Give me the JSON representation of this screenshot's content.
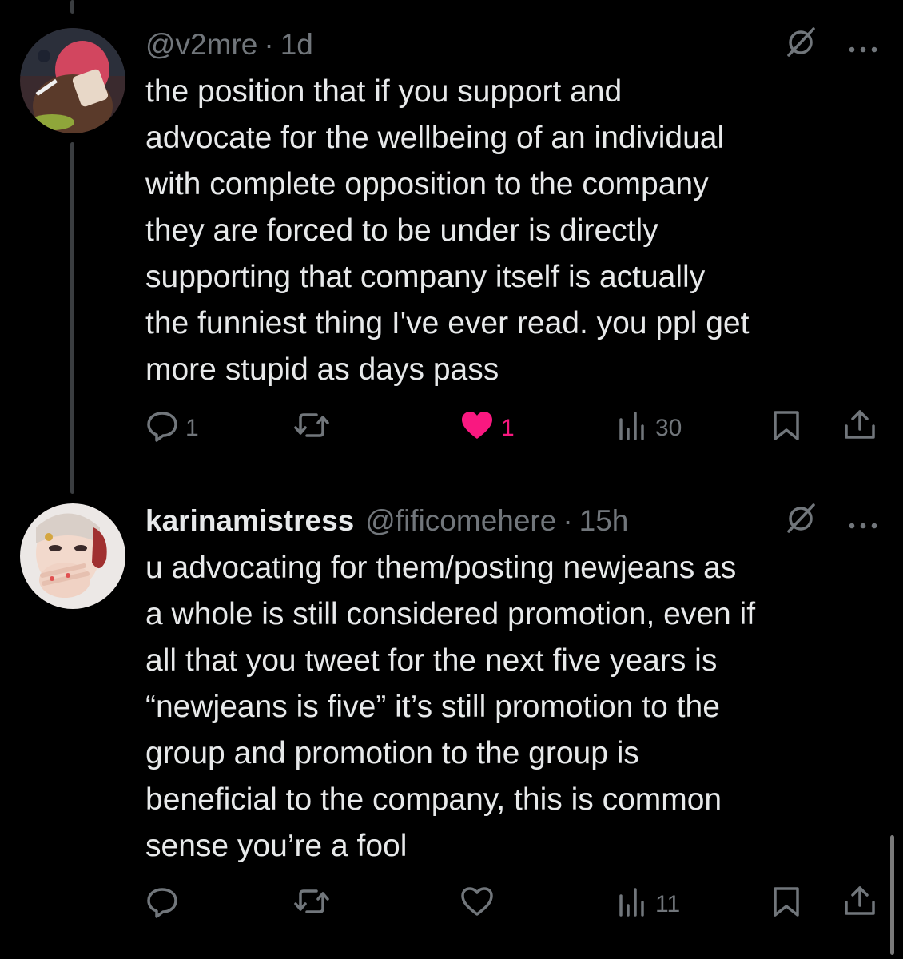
{
  "colors": {
    "background": "#000000",
    "text_primary": "#e7e9ea",
    "text_secondary": "#71767b",
    "like_active": "#f91880"
  },
  "tweets": [
    {
      "display_name": "",
      "handle": "@v2mre",
      "separator": "·",
      "time": "1d",
      "text_lines": [
        "the position that if you support and",
        "advocate for the wellbeing of an individual",
        "with complete opposition to the company",
        "they are forced to be under is directly",
        "supporting that company itself is actually",
        "the funniest thing I've ever read. you ppl get",
        "more stupid as days pass"
      ],
      "actions": {
        "reply_count": "1",
        "repost_count": "",
        "like_count": "1",
        "liked": true,
        "view_count": "30"
      },
      "icons": [
        "grok-icon",
        "more-icon",
        "reply-icon",
        "repost-icon",
        "like-icon",
        "views-icon",
        "bookmark-icon",
        "share-icon"
      ]
    },
    {
      "display_name": "karinamistress",
      "handle": "@fificomehere",
      "separator": "·",
      "time": "15h",
      "text_lines": [
        "u advocating for them/posting newjeans as",
        "a whole is still considered promotion, even if",
        "all that you tweet for the next five years is",
        "“newjeans is five” it’s still promotion to the",
        "group and promotion to the group is",
        "beneficial to the company, this is common",
        "sense you’re a fool"
      ],
      "actions": {
        "reply_count": "",
        "repost_count": "",
        "like_count": "",
        "liked": false,
        "view_count": "11"
      },
      "icons": [
        "grok-icon",
        "more-icon",
        "reply-icon",
        "repost-icon",
        "like-icon",
        "views-icon",
        "bookmark-icon",
        "share-icon"
      ]
    }
  ]
}
